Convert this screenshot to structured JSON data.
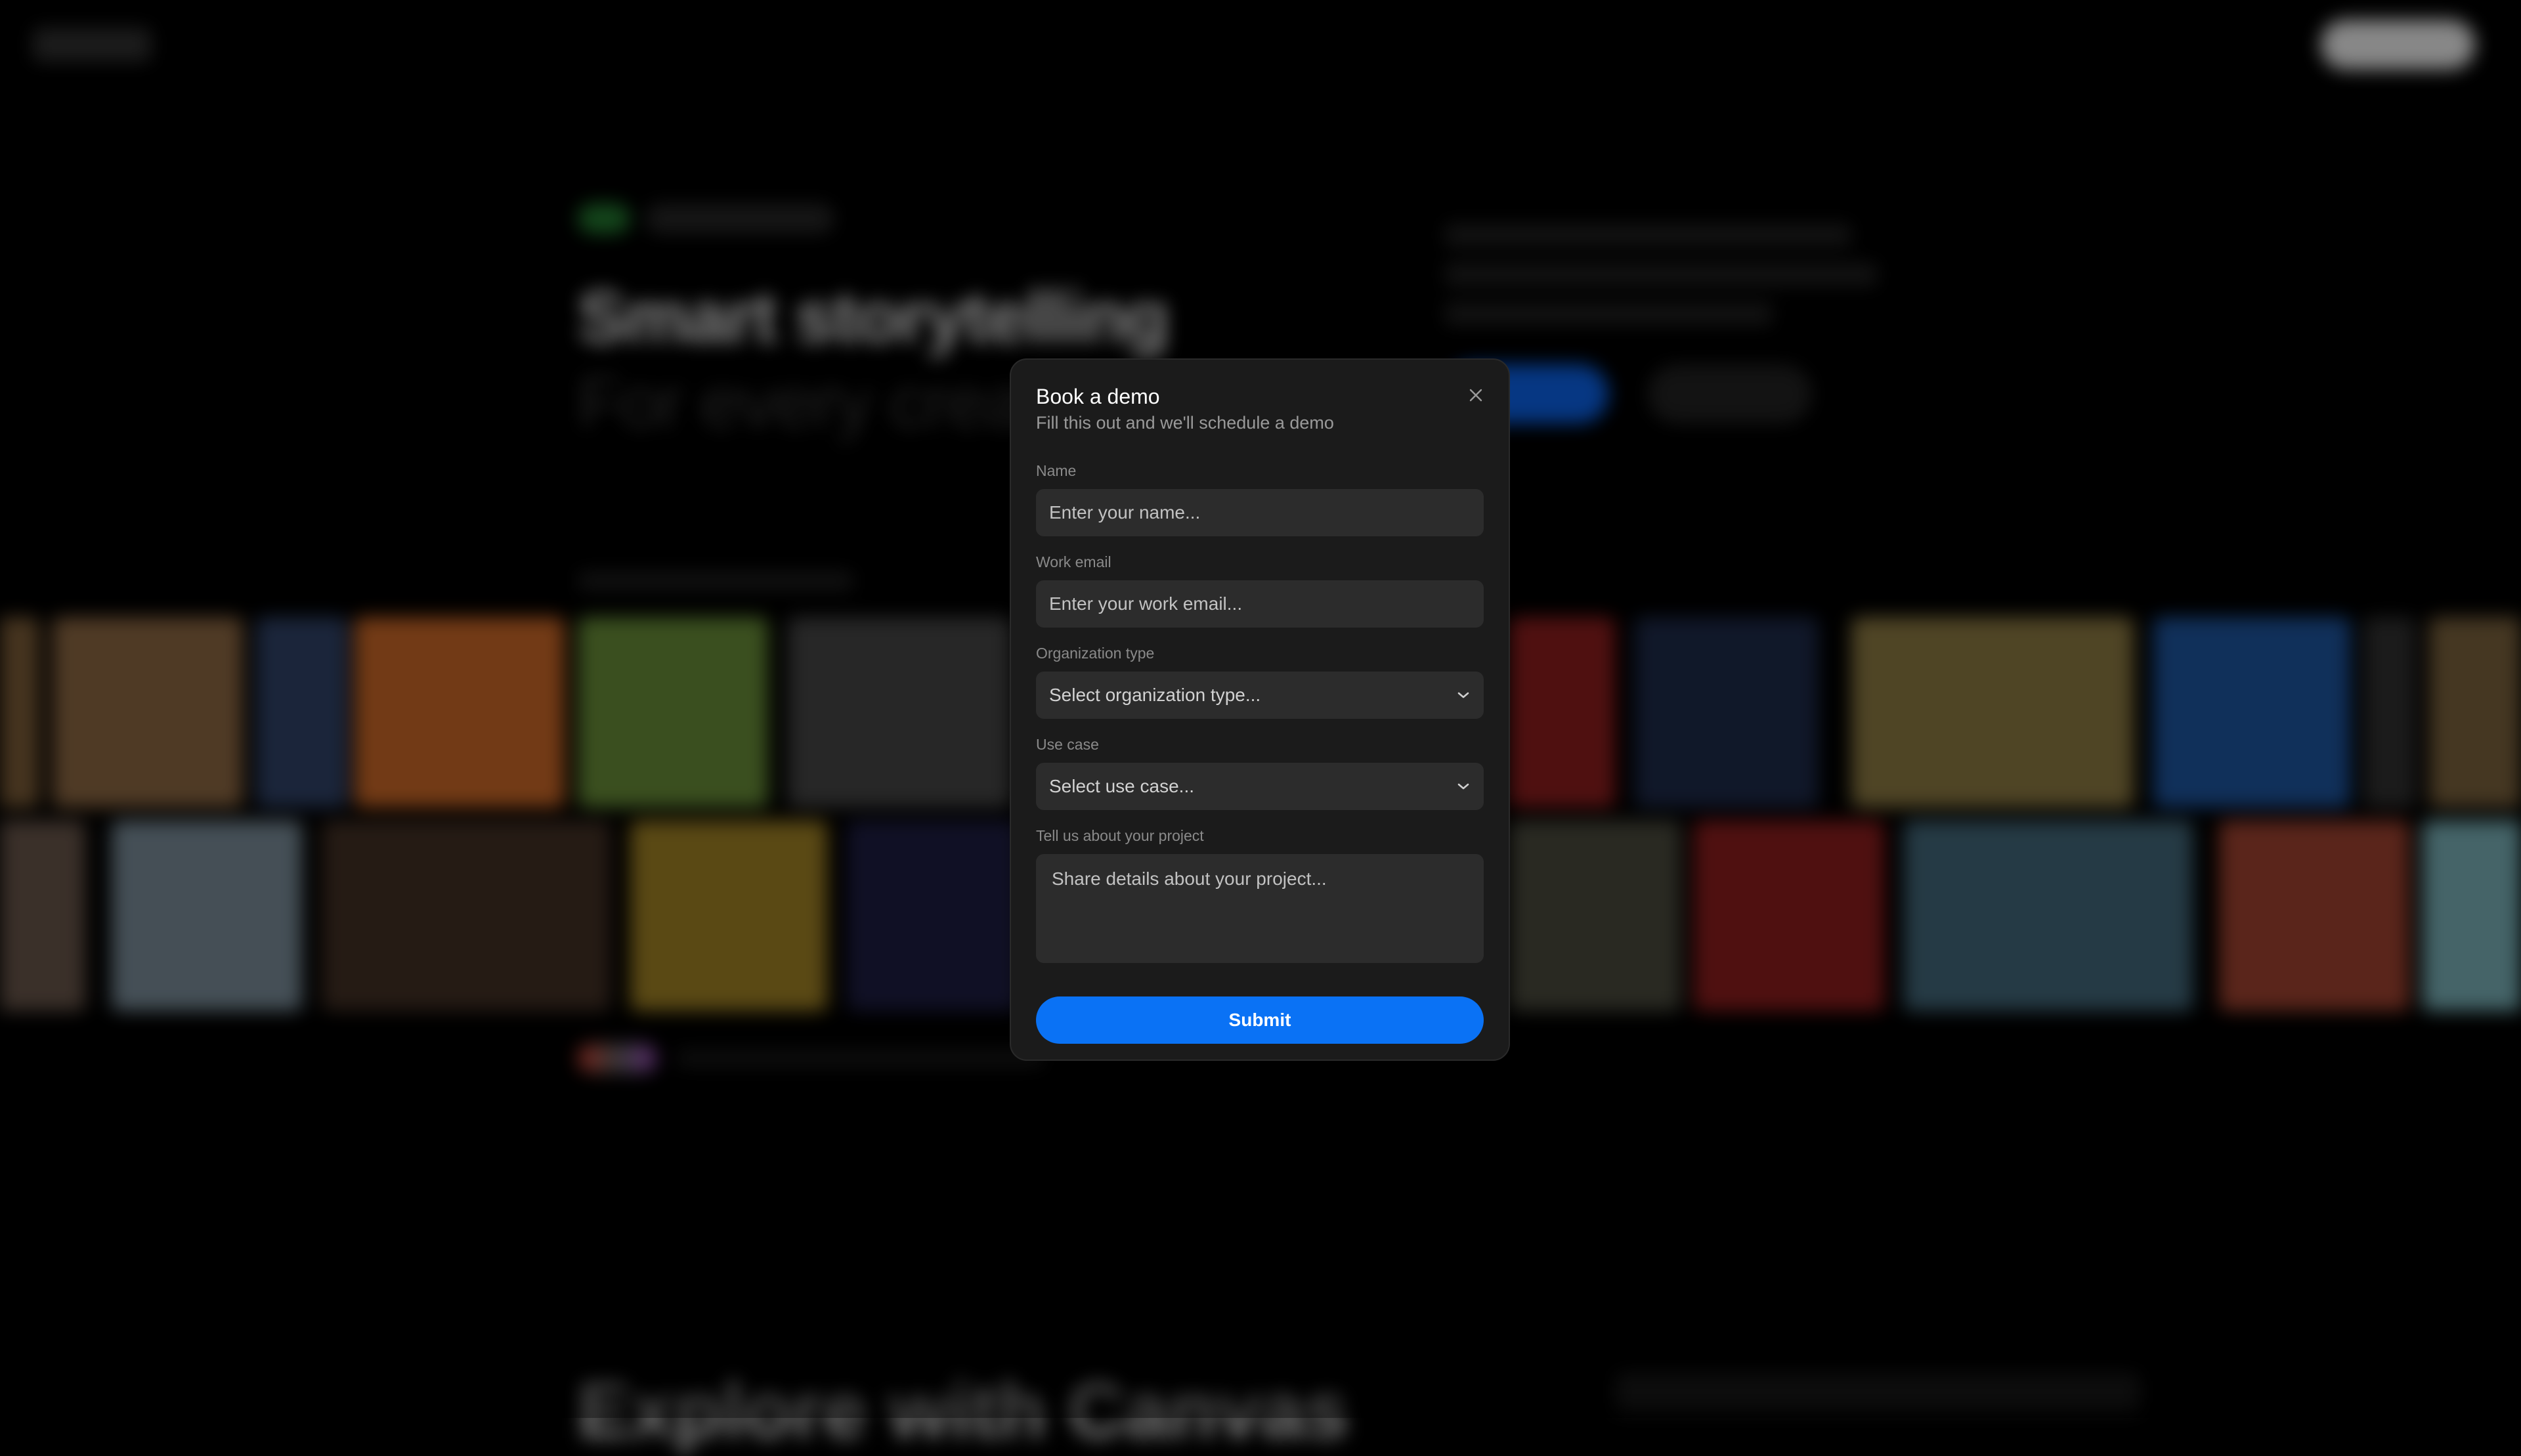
{
  "modal": {
    "title": "Book a demo",
    "subtitle": "Fill this out and we'll schedule a demo",
    "close_icon": "close-icon",
    "fields": {
      "name": {
        "label": "Name",
        "placeholder": "Enter your name..."
      },
      "email": {
        "label": "Work email",
        "placeholder": "Enter your work email..."
      },
      "organization": {
        "label": "Organization type",
        "selected": "Select organization type..."
      },
      "use_case": {
        "label": "Use case",
        "selected": "Select use case..."
      },
      "project": {
        "label": "Tell us about your project",
        "placeholder": "Share details about your project..."
      }
    },
    "submit_label": "Submit",
    "accent": "#0a72f5"
  },
  "background": {
    "hero_title": "Smart storytelling",
    "hero_subtitle": "For every creat",
    "explore_title": "Explore with Canvas"
  }
}
